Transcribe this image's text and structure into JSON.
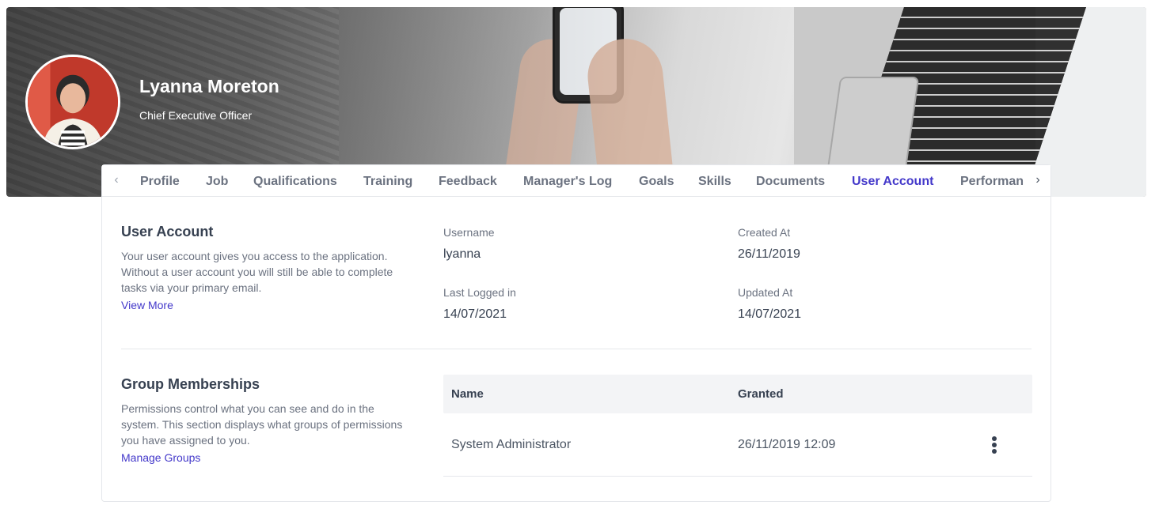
{
  "profile": {
    "name": "Lyanna Moreton",
    "job_title": "Chief Executive Officer"
  },
  "tabs": {
    "items": [
      {
        "label": "Profile"
      },
      {
        "label": "Job"
      },
      {
        "label": "Qualifications"
      },
      {
        "label": "Training"
      },
      {
        "label": "Feedback"
      },
      {
        "label": "Manager's Log"
      },
      {
        "label": "Goals"
      },
      {
        "label": "Skills"
      },
      {
        "label": "Documents"
      },
      {
        "label": "User Account"
      },
      {
        "label": "Performan"
      }
    ],
    "active": "User Account",
    "prev_icon": "chevron-left-icon",
    "next_icon": "chevron-right-icon"
  },
  "user_account": {
    "title": "User Account",
    "description": "Your user account gives you access to the application. Without a user account you will still be able to complete tasks via your primary email.",
    "link": "View More",
    "fields": {
      "username_label": "Username",
      "username_value": "lyanna",
      "created_label": "Created At",
      "created_value": "26/11/2019",
      "last_logged_label": "Last Logged in",
      "last_logged_value": "14/07/2021",
      "updated_label": "Updated At",
      "updated_value": "14/07/2021"
    }
  },
  "group_memberships": {
    "title": "Group Memberships",
    "description": "Permissions control what you can see and do in the system. This section displays what groups of permissions you have assigned to you.",
    "link": "Manage Groups",
    "columns": [
      "Name",
      "Granted"
    ],
    "rows": [
      {
        "name": "System Administrator",
        "granted": "26/11/2019 12:09",
        "actions_icon": "kebab-menu-icon"
      }
    ]
  },
  "colors": {
    "accent": "#4338ca",
    "text": "#374151",
    "muted": "#6b7280",
    "table_header_bg": "#f3f4f6"
  }
}
